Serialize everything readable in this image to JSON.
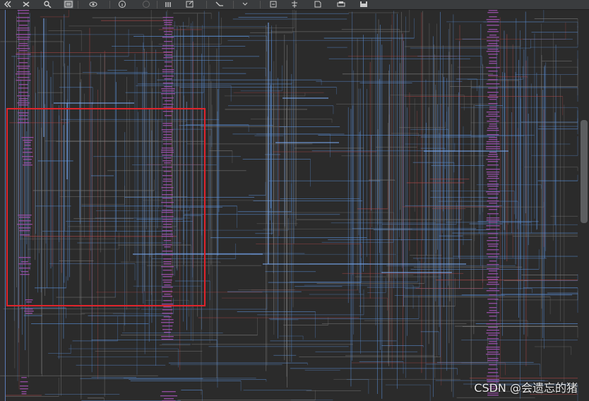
{
  "toolbar": {
    "buttons": [
      {
        "icon": "double-chevron-left-icon"
      },
      {
        "icon": "expand-icon"
      },
      {
        "icon": "zoom-search-icon"
      },
      {
        "icon": "schematic-view-icon",
        "active": true
      },
      {
        "icon": "eye-settings-icon"
      },
      {
        "icon": "info-icon"
      },
      {
        "icon": "cancel-circle-icon"
      },
      {
        "icon": "chip-icon"
      },
      {
        "icon": "export-icon"
      },
      {
        "icon": "route-icon"
      },
      {
        "icon": "dropdown-arrow-icon"
      },
      {
        "icon": "add-page-icon"
      },
      {
        "icon": "align-icon"
      },
      {
        "icon": "document-icon"
      },
      {
        "icon": "print-icon"
      },
      {
        "icon": "save-icon"
      }
    ]
  },
  "colors": {
    "background": "#2b2b2b",
    "wire_blue": "#5b8fd6",
    "wire_gray": "#7a7a7a",
    "wire_red": "#b04848",
    "instance_purple": "#9a4fa8",
    "highlight": "#e0242b"
  },
  "watermark": "CSDN @会遗忘的猪"
}
